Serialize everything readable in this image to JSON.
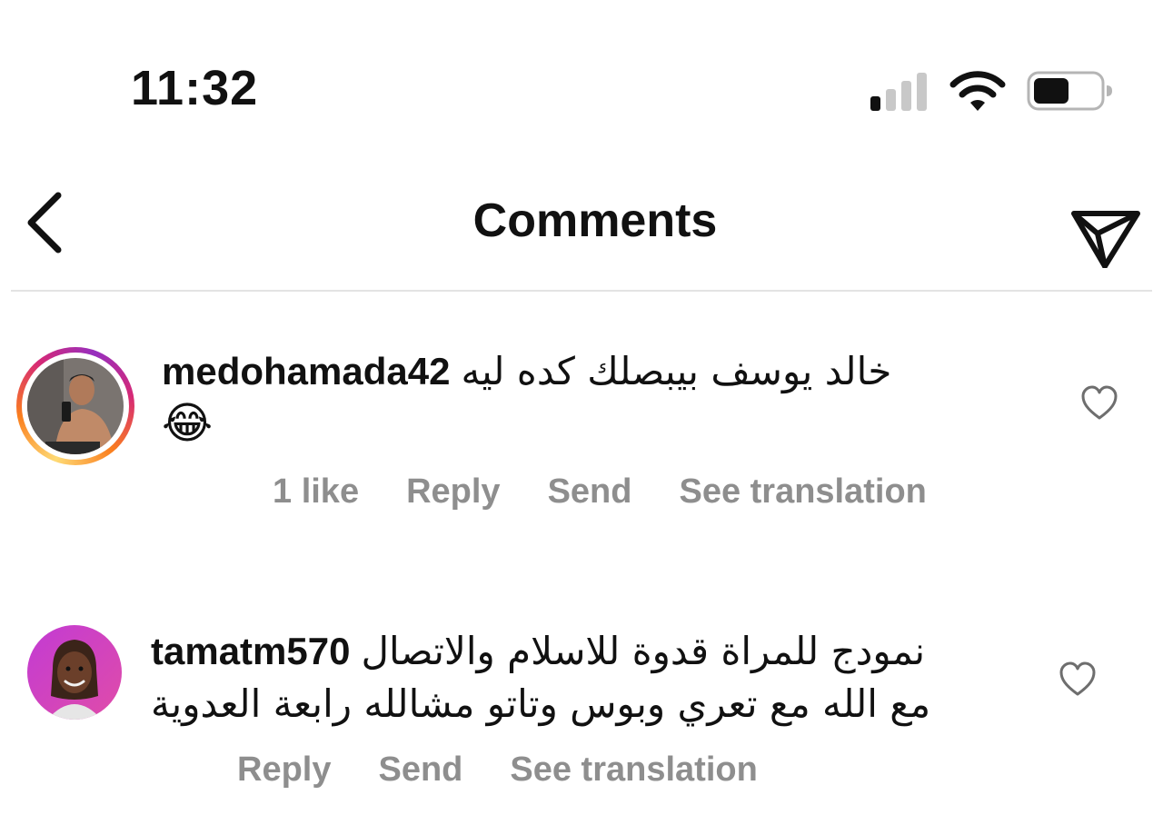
{
  "status_bar": {
    "time": "11:32",
    "signal_icon": "cellular-signal-icon",
    "wifi_icon": "wifi-icon",
    "battery_icon": "battery-icon"
  },
  "nav": {
    "title": "Comments",
    "back_icon": "chevron-left-icon",
    "share_icon": "paper-plane-icon"
  },
  "comments": [
    {
      "username": "medohamada42",
      "text": "خالد يوسف بيبصلك كده ليه",
      "emoji": "😂",
      "likes_label": "1 like",
      "reply_label": "Reply",
      "send_label": "Send",
      "translate_label": "See translation",
      "has_story_ring": true
    },
    {
      "username": "tamatm570",
      "text_line1": "نمودج للمراة قدوة للاسلام والاتصال",
      "text_line2": "مع الله مع تعري وبوس وتاتو مشالله رابعة العدوية",
      "reply_label": "Reply",
      "send_label": "Send",
      "translate_label": "See translation",
      "has_story_ring": false
    }
  ],
  "colors": {
    "action_gray": "#8e8e8e",
    "divider": "#e3e3e3"
  }
}
